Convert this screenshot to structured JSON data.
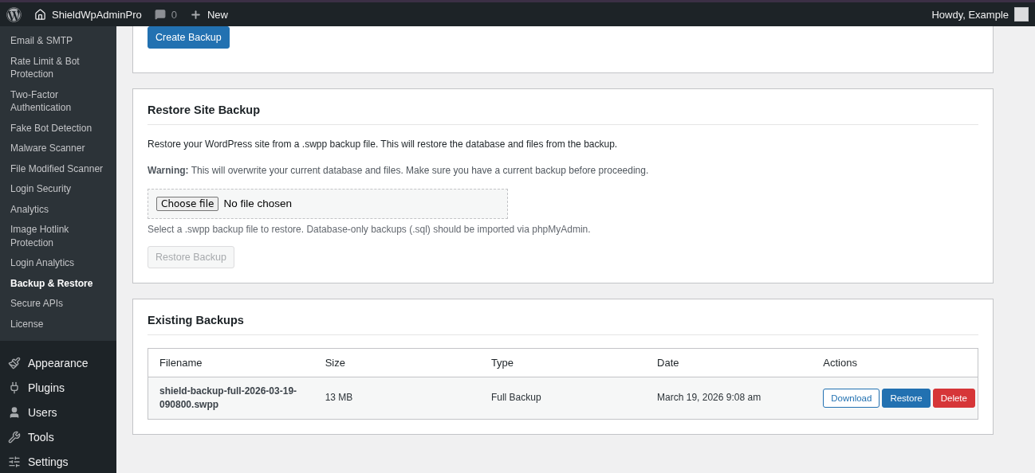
{
  "admin_bar": {
    "site_name": "ShieldWpAdminPro",
    "comments_count": "0",
    "new_label": "New",
    "greeting": "Howdy, Example"
  },
  "sidebar": {
    "submenu": [
      {
        "label": "Email & SMTP",
        "selected": false
      },
      {
        "label": "Rate Limit & Bot Protection",
        "selected": false
      },
      {
        "label": "Two-Factor Authentication",
        "selected": false
      },
      {
        "label": "Fake Bot Detection",
        "selected": false
      },
      {
        "label": "Malware Scanner",
        "selected": false
      },
      {
        "label": "File Modified Scanner",
        "selected": false
      },
      {
        "label": "Login Security",
        "selected": false
      },
      {
        "label": "Analytics",
        "selected": false
      },
      {
        "label": "Image Hotlink Protection",
        "selected": false
      },
      {
        "label": "Login Analytics",
        "selected": false
      },
      {
        "label": "Backup & Restore",
        "selected": true
      },
      {
        "label": "Secure APIs",
        "selected": false
      },
      {
        "label": "License",
        "selected": false
      }
    ],
    "menu": [
      {
        "label": "Appearance"
      },
      {
        "label": "Plugins"
      },
      {
        "label": "Users"
      },
      {
        "label": "Tools"
      },
      {
        "label": "Settings"
      }
    ]
  },
  "create_card": {
    "button": "Create Backup"
  },
  "restore_card": {
    "title": "Restore Site Backup",
    "description": "Restore your WordPress site from a .swpp backup file. This will restore the database and files from the backup.",
    "warning": "**Warning:** This will overwrite your current database and files. Make sure you have a current backup before proceeding.",
    "file_button": "Choose file",
    "file_status": "No file chosen",
    "hint": "Select a .swpp backup file to restore. Database-only backups (.sql) should be imported via phpMyAdmin.",
    "restore_button": {
      "label": "Restore Backup",
      "disabled": true
    }
  },
  "backups_card": {
    "title": "Existing Backups",
    "table": {
      "columns": [
        "Filename",
        "Size",
        "Type",
        "Date",
        "Actions"
      ],
      "rows": [
        {
          "filename": "shield-backup-full-2026-03-19-090800.swpp",
          "size": "13 MB",
          "type": "Full Backup",
          "date": "March 19, 2026 9:08 am",
          "actions": [
            {
              "label": "Download",
              "kind": "outline"
            },
            {
              "label": "Restore",
              "kind": "primary"
            },
            {
              "label": "Delete",
              "kind": "danger"
            }
          ]
        }
      ]
    }
  }
}
